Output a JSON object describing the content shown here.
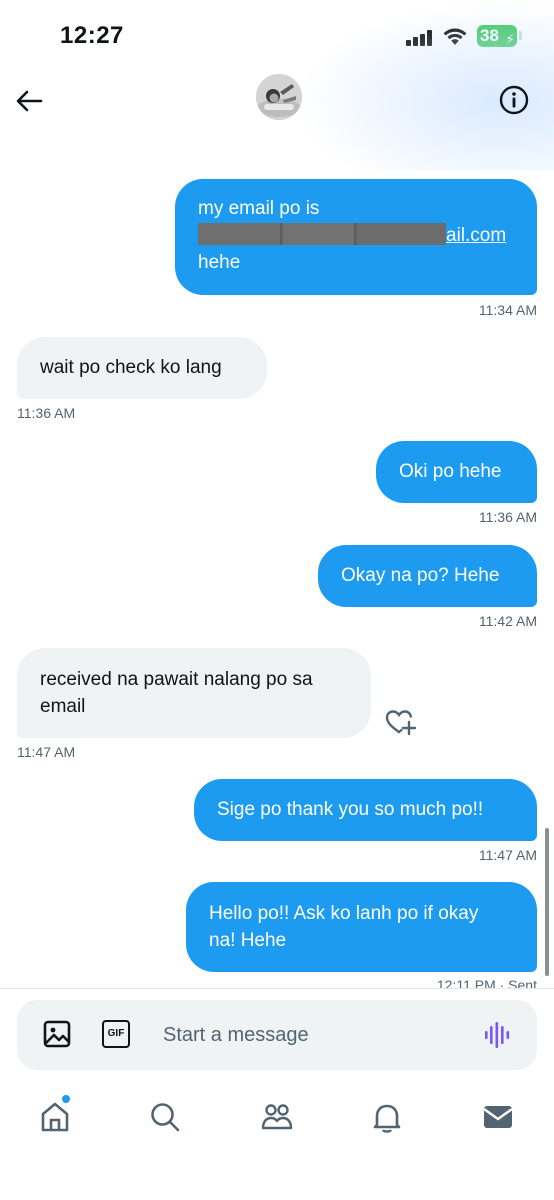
{
  "status_bar": {
    "time": "12:27",
    "battery_level": "38"
  },
  "header": {
    "back_icon": "arrow-left-icon",
    "info_icon": "info-circle-icon"
  },
  "messages": [
    {
      "direction": "sent",
      "line1": "my email po is",
      "email_suffix": "ail.com",
      "line3": "hehe",
      "time": "11:34 AM"
    },
    {
      "direction": "received",
      "text": "wait po check ko lang",
      "time": "11:36 AM"
    },
    {
      "direction": "sent",
      "text": "Oki po hehe",
      "time": "11:36 AM"
    },
    {
      "direction": "sent",
      "text": "Okay na po? Hehe",
      "time": "11:42 AM"
    },
    {
      "direction": "received",
      "line1": "received na pawait nalang po sa",
      "line2": "email",
      "time": "11:47 AM"
    },
    {
      "direction": "sent",
      "text": "Sige po thank you so much po!!",
      "time": "11:47 AM"
    },
    {
      "direction": "sent",
      "line1": "Hello po!! Ask ko lanh po if okay",
      "line2": "na! Hehe",
      "time": "12:11 PM · Sent"
    }
  ],
  "composer": {
    "placeholder": "Start a message",
    "gif_label": "GIF"
  },
  "nav": {
    "items": [
      "home-icon",
      "search-icon",
      "communities-icon",
      "notifications-icon",
      "messages-icon"
    ]
  },
  "colors": {
    "accent": "#1d9bf0",
    "received_bubble": "#eff3f4",
    "voice_accent": "#7856ff"
  }
}
